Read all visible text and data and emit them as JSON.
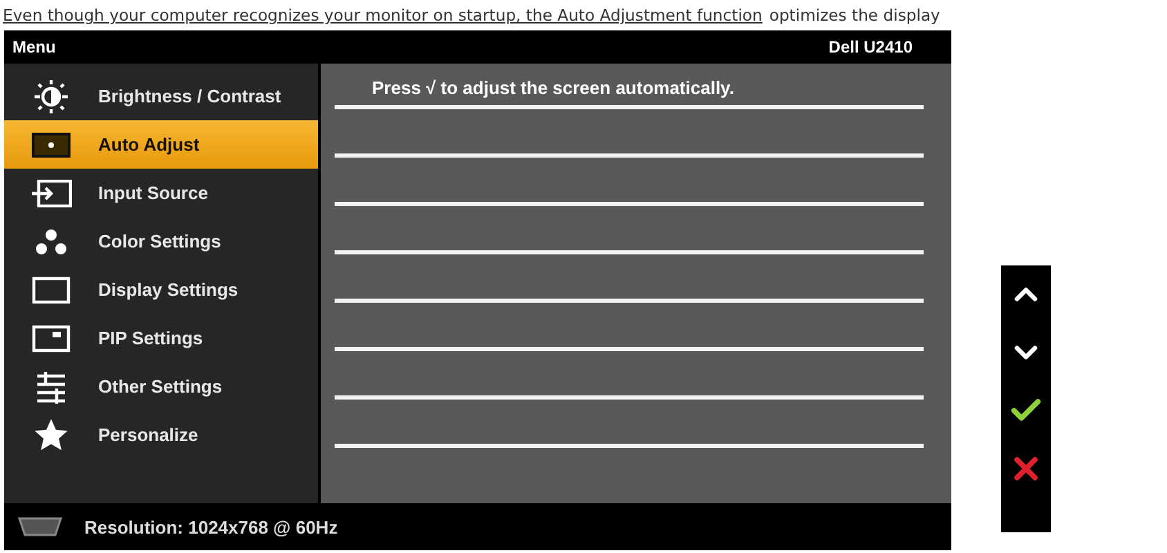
{
  "intro": {
    "link": "Even though your computer recognizes your monitor on startup, the Auto Adjustment function",
    "rest": "optimizes the display"
  },
  "osd": {
    "title": "Menu",
    "model": "Dell U2410",
    "menu_items": [
      {
        "label": "Brightness / Contrast",
        "kind": "brightness",
        "selected": false
      },
      {
        "label": "Auto Adjust",
        "kind": "auto",
        "selected": true
      },
      {
        "label": "Input Source",
        "kind": "input",
        "selected": false
      },
      {
        "label": "Color Settings",
        "kind": "color",
        "selected": false
      },
      {
        "label": "Display Settings",
        "kind": "display",
        "selected": false
      },
      {
        "label": "PIP Settings",
        "kind": "pip",
        "selected": false
      },
      {
        "label": "Other Settings",
        "kind": "other",
        "selected": false
      },
      {
        "label": "Personalize",
        "kind": "star",
        "selected": false
      }
    ],
    "message": "Press √ to adjust the screen automatically.",
    "status": "Resolution: 1024x768 @ 60Hz"
  },
  "buttons": [
    {
      "kind": "up"
    },
    {
      "kind": "down"
    },
    {
      "kind": "ok"
    },
    {
      "kind": "exit"
    }
  ]
}
